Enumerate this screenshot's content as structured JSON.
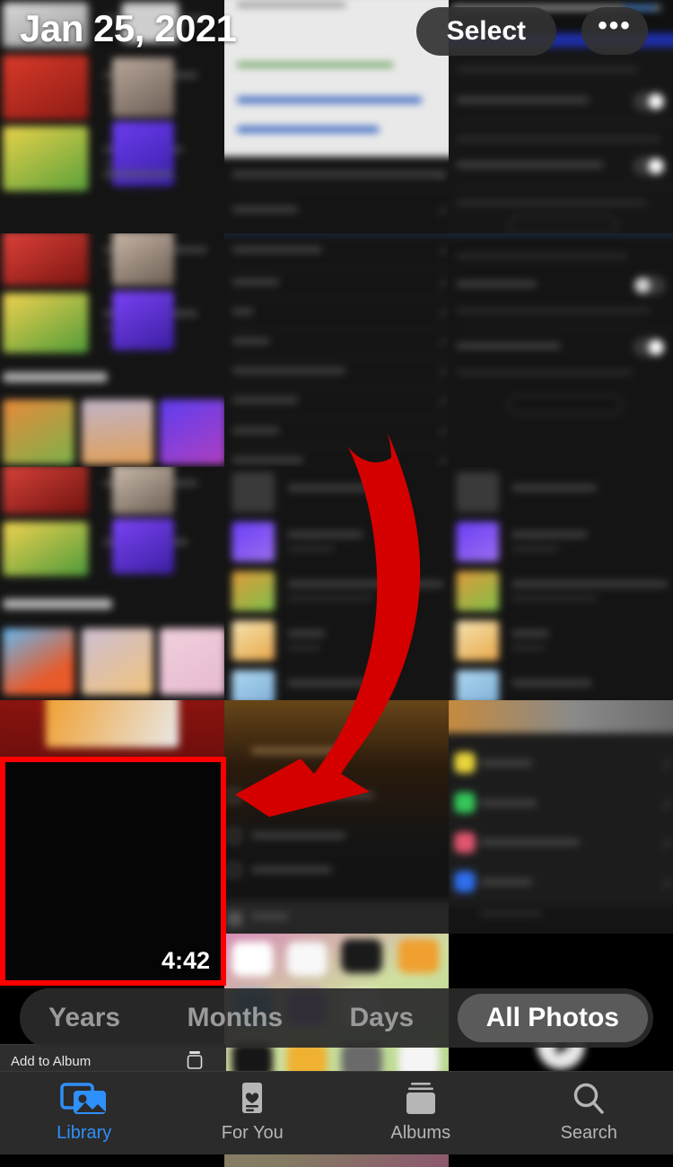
{
  "app": {
    "name": "Photos",
    "accent_color": "#2e90fa",
    "highlight_color": "#FF0000",
    "background": "#000000"
  },
  "header": {
    "date_label": "Jan 25, 2021",
    "select_label": "Select",
    "more_label": "•••",
    "more_icon": "ellipsis-icon"
  },
  "grid": {
    "columns": 3,
    "highlighted_item": {
      "type": "video",
      "duration": "4:42",
      "border_color": "#FF0000"
    },
    "play_indicator_icon": "play-circle-icon",
    "items": [
      {
        "row": 1,
        "col": 1,
        "kind": "app-list-dark"
      },
      {
        "row": 1,
        "col": 2,
        "kind": "browser-search"
      },
      {
        "row": 1,
        "col": 3,
        "kind": "social-post"
      },
      {
        "row": 2,
        "col": 1,
        "kind": "music-library"
      },
      {
        "row": 2,
        "col": 2,
        "kind": "settings-list"
      },
      {
        "row": 2,
        "col": 3,
        "kind": "settings-toggles"
      },
      {
        "row": 3,
        "col": 1,
        "kind": "music-recently-played"
      },
      {
        "row": 3,
        "col": 2,
        "kind": "playlist-rows"
      },
      {
        "row": 3,
        "col": 3,
        "kind": "playlist-rows"
      },
      {
        "row": 4,
        "col": 1,
        "kind": "album-red"
      },
      {
        "row": 4,
        "col": 2,
        "kind": "context-menu"
      },
      {
        "row": 4,
        "col": 3,
        "kind": "share-sheet"
      },
      {
        "row": 5,
        "col": 1,
        "kind": "video-black"
      },
      {
        "row": 5,
        "col": 2,
        "kind": "home-screen"
      },
      {
        "row": 5,
        "col": 3,
        "kind": "video-play"
      }
    ]
  },
  "annotation": {
    "arrow_icon": "curved-arrow-icon",
    "arrow_color": "#D40000",
    "direction": "down-left"
  },
  "filter_bar": {
    "options": [
      {
        "label": "Years",
        "active": false
      },
      {
        "label": "Months",
        "active": false
      },
      {
        "label": "Days",
        "active": false
      },
      {
        "label": "All Photos",
        "active": true
      }
    ]
  },
  "context_sliver": {
    "label": "Add to Album",
    "icon": "add-to-album-icon"
  },
  "tab_bar": {
    "tabs": [
      {
        "label": "Library",
        "icon": "photos-library-icon",
        "active": true
      },
      {
        "label": "For You",
        "icon": "heart-card-icon",
        "active": false
      },
      {
        "label": "Albums",
        "icon": "albums-icon",
        "active": false
      },
      {
        "label": "Search",
        "icon": "search-icon",
        "active": false
      }
    ]
  }
}
